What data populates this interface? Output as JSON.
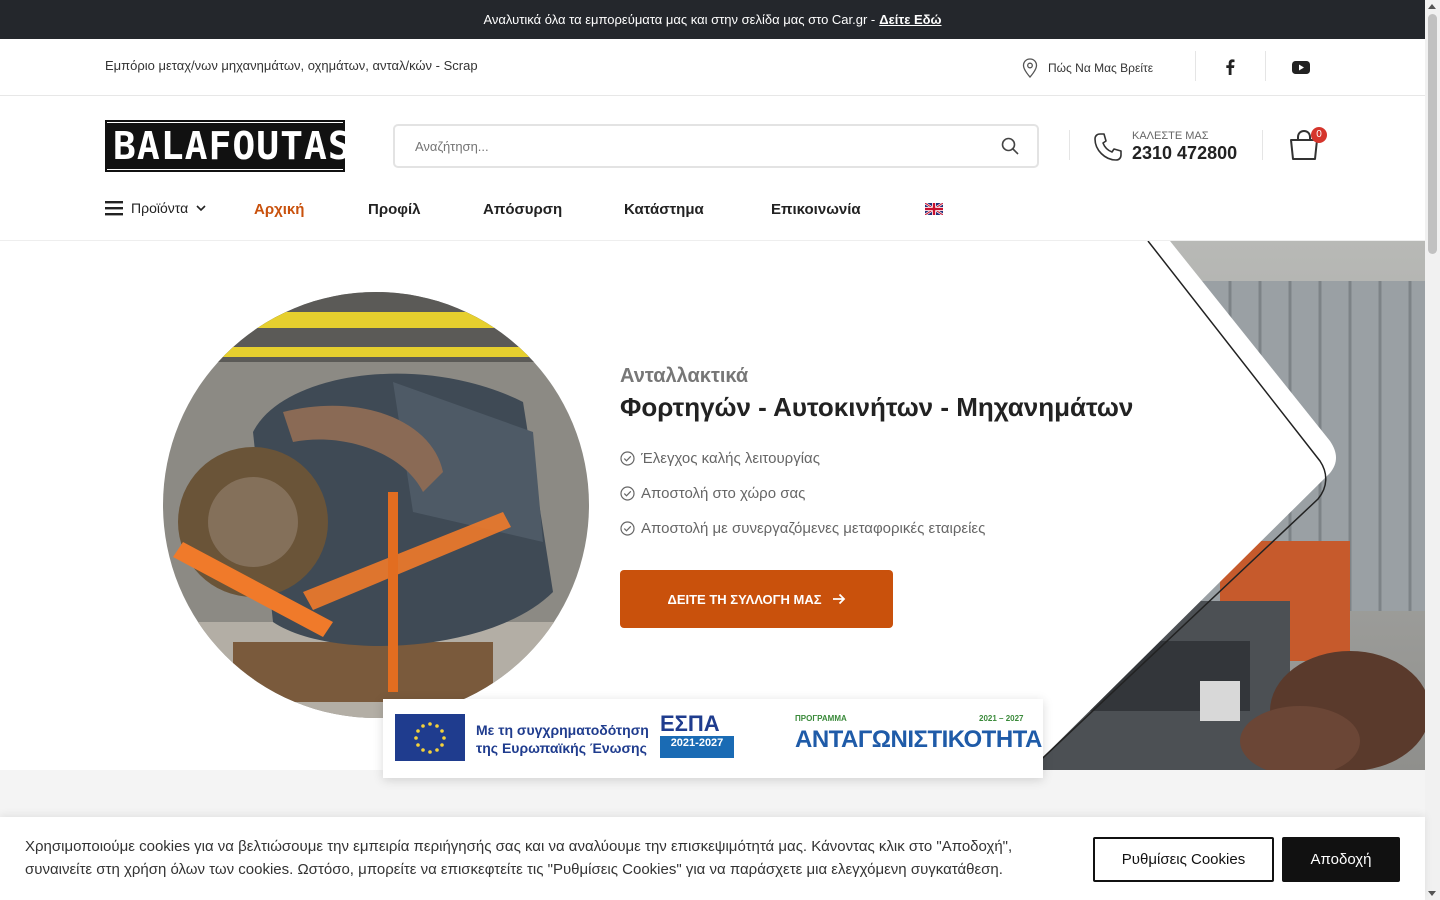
{
  "announcement": {
    "text": "Αναλυτικά όλα τα εμπορεύματα μας και στην σελίδα μας στο Car.gr -",
    "link": "Δείτε Εδώ"
  },
  "infobar": {
    "tagline": "Εμπόριο μεταχ/νων μηχανημάτων, οχημάτων, ανταλ/κών - Scrap",
    "find_us": "Πώς Να Μας Βρείτε",
    "social": [
      "facebook-icon",
      "youtube-icon"
    ]
  },
  "header": {
    "logo": "BALAFOUTAS",
    "search_placeholder": "Αναζήτηση...",
    "call_label": "ΚΑΛΕΣΤΕ ΜΑΣ",
    "phone": "2310 472800",
    "cart_count": "0"
  },
  "nav": {
    "products": "Προϊόντα",
    "items": [
      "Αρχική",
      "Προφίλ",
      "Απόσυρση",
      "Κατάστημα",
      "Επικοινωνία"
    ],
    "active_index": 0
  },
  "hero": {
    "subtitle": "Ανταλλακτικά",
    "title": "Φορτηγών - Αυτοκινήτων - Μηχανημάτων",
    "features": [
      "Έλεγχος καλής λειτουργίας",
      "Αποστολή στο χώρο σας",
      "Αποστολή με συνεργαζόμενες μεταφορικές εταιρείες"
    ],
    "cta": "ΔΕΙΤΕ ΤΗ ΣΥΛΛΟΓΗ ΜΑΣ"
  },
  "espa": {
    "eu_line1": "Με τη συγχρηματοδότηση",
    "eu_line2": "της Ευρωπαϊκής Ένωσης",
    "espa": "ΕΣΠΑ",
    "espa_years": "2021-2027",
    "program": "ΠΡΟΓΡΑΜΜΑ",
    "program_years": "2021 – 2027",
    "program_name": "ΑΝΤΑΓΩΝΙΣΤΙΚΟΤΗΤΑ"
  },
  "cookie": {
    "text": "Χρησιμοποιούμε cookies για να βελτιώσουμε την εμπειρία περιήγησής σας και να αναλύουμε την επισκεψιμότητά μας. Κάνοντας κλικ στο \"Αποδοχή\", συναινείτε στη χρήση όλων των cookies. Ωστόσο, μπορείτε να επισκεφτείτε τις \"Ρυθμίσεις Cookies\" για να παράσχετε μια ελεγχόμενη συγκατάθεση.",
    "settings": "Ρυθμίσεις Cookies",
    "accept": "Αποδοχή"
  },
  "colors": {
    "accent": "#c9510c",
    "topbar": "#24272c",
    "badge": "#d5352c"
  }
}
